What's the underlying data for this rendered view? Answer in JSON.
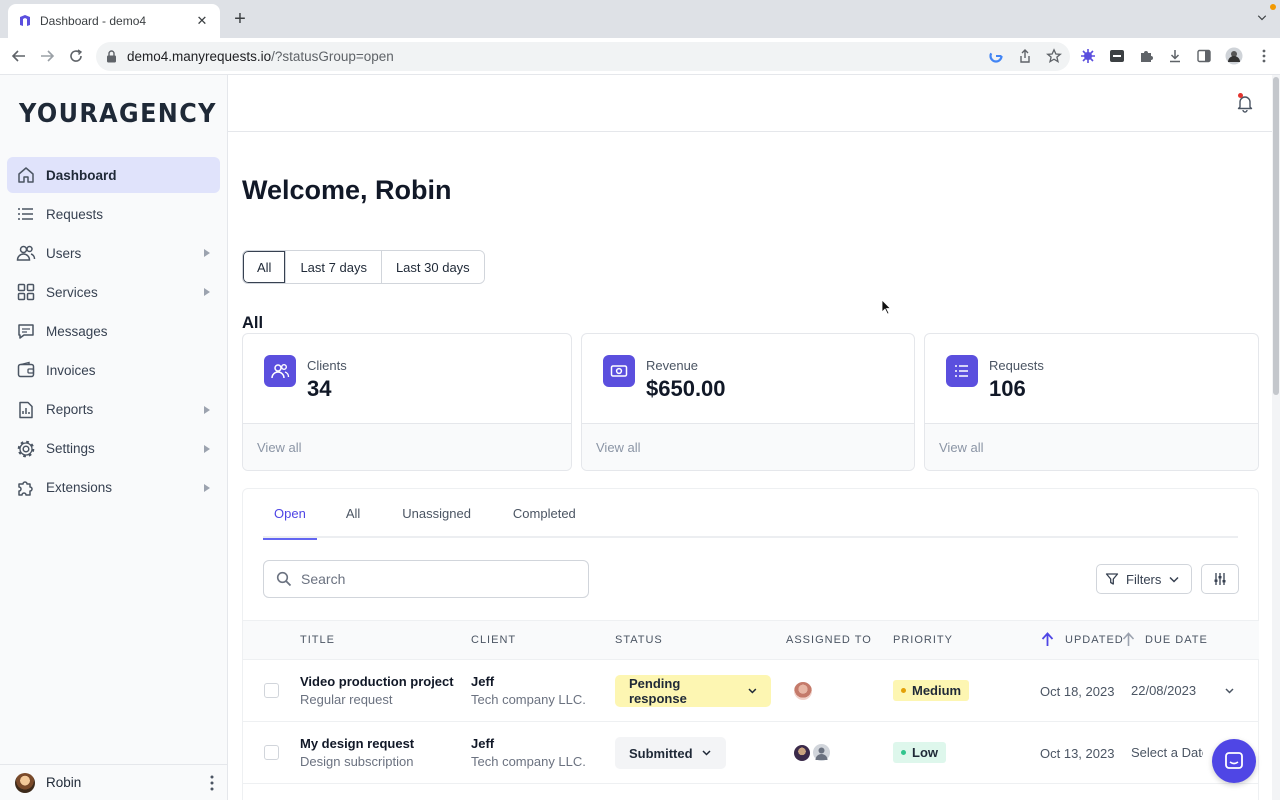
{
  "browser": {
    "tab_title": "Dashboard - demo4",
    "url_host": "demo4.manyrequests.io",
    "url_path": "/?statusGroup=open"
  },
  "sidebar": {
    "logo": "YOURAGENCY",
    "items": [
      {
        "label": "Dashboard",
        "icon": "home-icon",
        "active": true,
        "has_submenu": false
      },
      {
        "label": "Requests",
        "icon": "list-icon",
        "active": false,
        "has_submenu": false
      },
      {
        "label": "Users",
        "icon": "users-icon",
        "active": false,
        "has_submenu": true
      },
      {
        "label": "Services",
        "icon": "grid-icon",
        "active": false,
        "has_submenu": true
      },
      {
        "label": "Messages",
        "icon": "chat-icon",
        "active": false,
        "has_submenu": false
      },
      {
        "label": "Invoices",
        "icon": "wallet-icon",
        "active": false,
        "has_submenu": false
      },
      {
        "label": "Reports",
        "icon": "chart-icon",
        "active": false,
        "has_submenu": true
      },
      {
        "label": "Settings",
        "icon": "gear-icon",
        "active": false,
        "has_submenu": true
      },
      {
        "label": "Extensions",
        "icon": "puzzle-icon",
        "active": false,
        "has_submenu": true
      }
    ],
    "user_name": "Robin"
  },
  "main": {
    "welcome": "Welcome, Robin",
    "ranges": [
      "All",
      "Last 7 days",
      "Last 30 days"
    ],
    "selected_range": "All",
    "section_title": "All",
    "cards": [
      {
        "label": "Clients",
        "value": "34",
        "link": "View all",
        "icon": "users-icon"
      },
      {
        "label": "Revenue",
        "value": "$650.00",
        "link": "View all",
        "icon": "cash-icon"
      },
      {
        "label": "Requests",
        "value": "106",
        "link": "View all",
        "icon": "list-icon"
      }
    ]
  },
  "requests": {
    "tabs": [
      "Open",
      "All",
      "Unassigned",
      "Completed"
    ],
    "active_tab": "Open",
    "search_placeholder": "Search",
    "filters_label": "Filters",
    "columns": [
      "Title",
      "Client",
      "Status",
      "Assigned to",
      "Priority",
      "Updated",
      "Due date"
    ],
    "rows": [
      {
        "title": "Video production project",
        "type": "Regular request",
        "client": "Jeff",
        "company": "Tech company LLC.",
        "status": "Pending response",
        "status_color": "#fdf6b2",
        "priority": "Medium",
        "priority_bg": "#fdf6b2",
        "priority_dot": "#e3a008",
        "updated": "Oct 18, 2023",
        "due": "22/08/2023"
      },
      {
        "title": "My design request",
        "type": "Design subscription",
        "client": "Jeff",
        "company": "Tech company LLC.",
        "status": "Submitted",
        "status_color": "#f3f4f6",
        "priority": "Low",
        "priority_bg": "#def7ec",
        "priority_dot": "#31c48d",
        "updated": "Oct 13, 2023",
        "due": "Select a Date"
      }
    ]
  },
  "colors": {
    "accent": "#5b4fde",
    "active_nav_bg": "#e0e3fb",
    "fab": "#4f46e5"
  }
}
